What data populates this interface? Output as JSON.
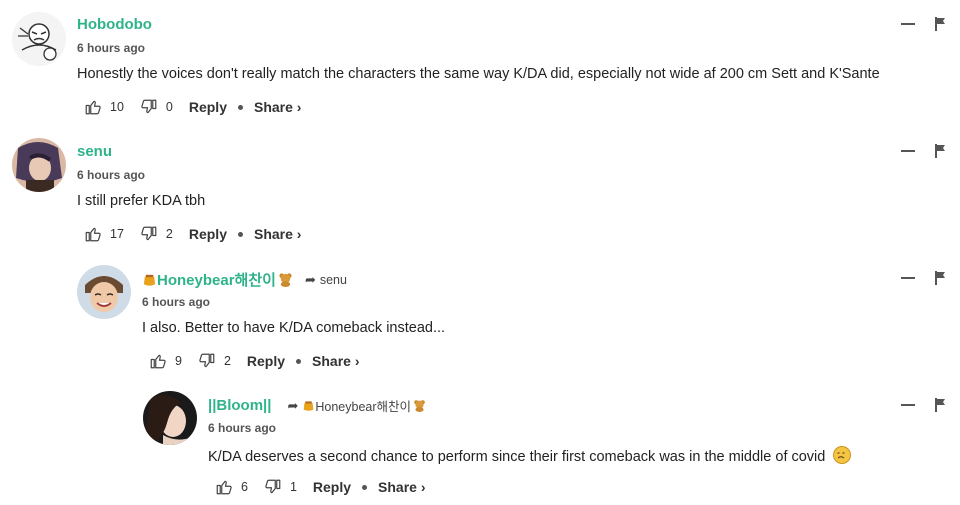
{
  "comments": [
    {
      "username": "Hobodobo",
      "time": "6 hours ago",
      "text": "Honestly the voices don't really match the characters the same way K/DA did, especially not wide af 200 cm Sett and K'Sante",
      "likes": "10",
      "dislikes": "0",
      "reply_label": "Reply",
      "share_label": "Share ›"
    },
    {
      "username": "senu",
      "time": "6 hours ago",
      "text": "I still prefer KDA tbh",
      "likes": "17",
      "dislikes": "2",
      "reply_label": "Reply",
      "share_label": "Share ›"
    },
    {
      "username": "Honeybear해찬이",
      "reply_to": "senu",
      "time": "6 hours ago",
      "text": "I also. Better to have K/DA comeback instead...",
      "likes": "9",
      "dislikes": "2",
      "reply_label": "Reply",
      "share_label": "Share ›"
    },
    {
      "username": "||Bloom||",
      "reply_to": "Honeybear해찬이",
      "time": "6 hours ago",
      "text": "K/DA deserves a second chance to perform since their first comeback was in the middle of covid",
      "likes": "6",
      "dislikes": "1",
      "reply_label": "Reply",
      "share_label": "Share ›"
    }
  ],
  "colors": {
    "username": "#2fb38a",
    "text": "#222222",
    "icon": "#555555"
  },
  "icons": [
    "thumbs-up-icon",
    "thumbs-down-icon",
    "minimize-icon",
    "flag-icon",
    "reply-arrow-icon",
    "honey-pot-icon",
    "teddy-bear-icon",
    "sad-face-emoji-icon"
  ]
}
